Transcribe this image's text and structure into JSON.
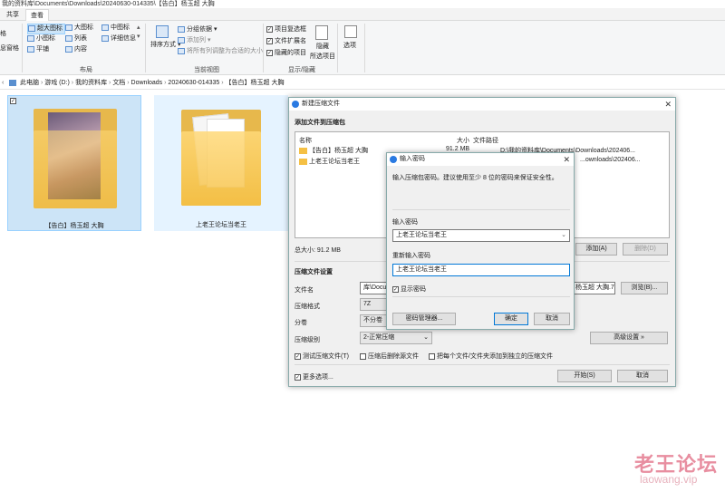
{
  "window": {
    "path_title": "我的资料库\\Documents\\Downloads\\20240630-014335\\【告白】杨玉超 大胸"
  },
  "tabs": [
    {
      "label": "共享"
    },
    {
      "label": "查看"
    }
  ],
  "ribbon": {
    "left_cut": [
      "格",
      "息窗格"
    ],
    "layout": {
      "items": [
        "超大图标",
        "大图标",
        "中图标",
        "小图标",
        "列表",
        "详细信息",
        "平铺",
        "内容"
      ],
      "label": "布局"
    },
    "current_view": {
      "sort": "排序方式",
      "group_by": "分组依据",
      "add_column": "添加列",
      "fit_columns": "将所有列调整为合适的大小",
      "label": "当前视图"
    },
    "show_hide": {
      "checkbox_items": [
        "项目复选框",
        "文件扩展名",
        "隐藏的项目"
      ],
      "hide_selected": "隐藏\n所选项目",
      "label": "显示/隐藏"
    },
    "options": "选项"
  },
  "breadcrumb": [
    "此电脑",
    "游戏 (D:)",
    "我的资料库",
    "文档",
    "Downloads",
    "20240630-014335",
    "【告白】杨玉超 大胸"
  ],
  "files": [
    {
      "name": "【告白】杨玉超 大胸"
    },
    {
      "name": "上老王论坛当老王"
    }
  ],
  "archive_dialog": {
    "title": "新建压缩文件",
    "section_add": "添加文件到压缩包",
    "columns": {
      "name": "名称",
      "size": "大小",
      "path": "文件路径"
    },
    "rows": [
      {
        "name": "【告白】杨玉超 大胸",
        "size": "91.2 MB",
        "path": "D:\\我的资料库\\Documents\\Downloads\\202406..."
      },
      {
        "name": "上老王论坛当老王",
        "size": "",
        "path": "...ownloads\\202406..."
      }
    ],
    "total": "总大小: 91.2 MB",
    "add_button": "添加(A)",
    "delete_button": "删除(D)",
    "section_settings": "压缩文件设置",
    "filename_label": "文件名",
    "filename_value": "库\\Docum",
    "filename_tail": "杨玉超 大胸.7z",
    "browse_button": "浏览(B)...",
    "format_label": "压缩格式",
    "format_value": "7Z",
    "split_label": "分卷",
    "split_value": "不分卷",
    "level_label": "压缩级别",
    "level_value": "2-正常压缩",
    "advanced_button": "高级设置 »",
    "check_test": "测试压缩文件(T)",
    "check_delete": "压缩后删除源文件",
    "check_each": "把每个文件/文件夹添加到独立的压缩文件",
    "more_options": "更多选项...",
    "start_button": "开始(S)",
    "cancel_button": "取消"
  },
  "password_dialog": {
    "title": "输入密码",
    "hint": "输入压缩包密码。建议使用至少 8 位的密码来保证安全性。",
    "enter_label": "输入密码",
    "enter_value": "上老王论坛当老王",
    "reenter_label": "重新输入密码",
    "reenter_value": "上老王论坛当老王",
    "show_password": "显示密码",
    "manager_button": "密码管理器...",
    "ok_button": "确定",
    "cancel_button": "取消"
  },
  "watermark": {
    "text": "老王论坛",
    "url": "laowang.vip"
  },
  "colors": {
    "accent": "#0078d7",
    "folder": "#f5c044",
    "watermark": "#e88ea0"
  }
}
